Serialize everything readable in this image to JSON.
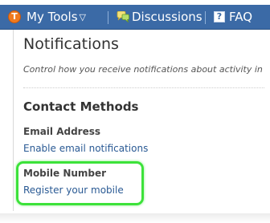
{
  "nav": {
    "my_tools_label": "My Tools",
    "discussions_label": "Discussions",
    "faq_label": "FAQ",
    "logo_letter": "T",
    "faq_icon_glyph": "?",
    "icons": [
      "brand-logo-icon",
      "chevron-down-icon",
      "speech-bubbles-icon",
      "help-icon"
    ],
    "colors": {
      "bar": "#3b6aa6",
      "logo": "#f07a1e"
    }
  },
  "page": {
    "title": "Notifications",
    "description": "Control how you receive notifications about activity in"
  },
  "contact_methods": {
    "heading": "Contact Methods",
    "email": {
      "label": "Email Address",
      "link": "Enable email notifications"
    },
    "mobile": {
      "label": "Mobile Number",
      "link": "Register your mobile",
      "highlight_color": "#3ce23a"
    }
  }
}
